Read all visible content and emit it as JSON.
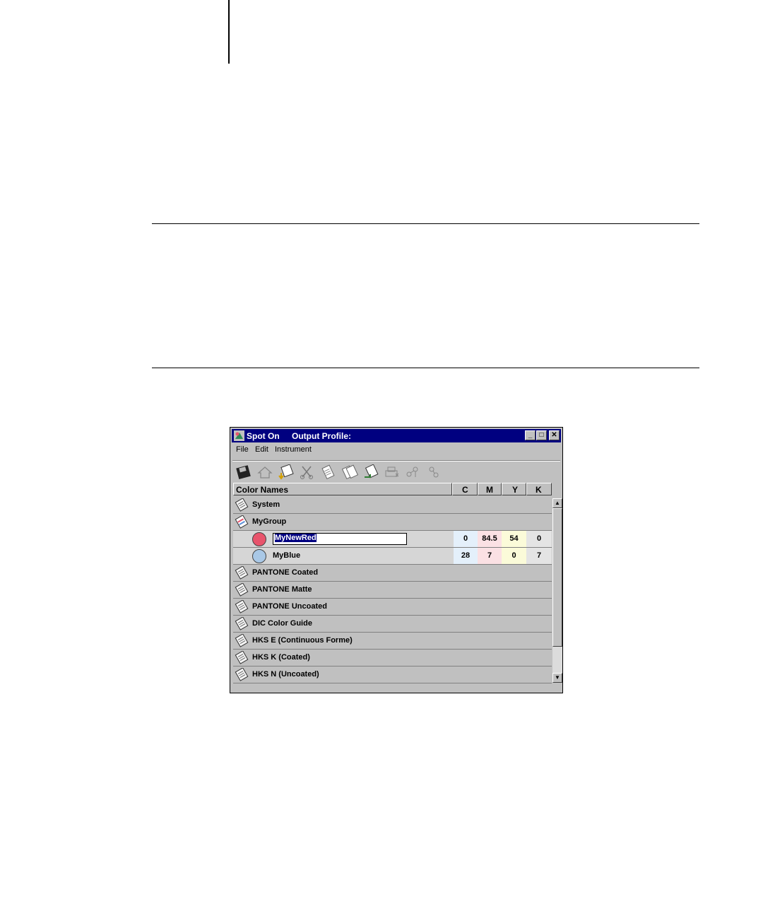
{
  "window": {
    "title": "Spot On",
    "subtitle": "Output Profile:",
    "minimize": "_",
    "maximize": "□",
    "close": "✕"
  },
  "menu": {
    "file": "File",
    "edit": "Edit",
    "instrument": "Instrument"
  },
  "toolbar": [
    "save-icon",
    "home-icon",
    "download-icon",
    "cut-icon",
    "copy-icon",
    "paste-icon",
    "import-icon",
    "print-icon",
    "measure-icon",
    "link-icon"
  ],
  "columns": {
    "name": "Color Names",
    "c": "C",
    "m": "M",
    "y": "Y",
    "k": "K"
  },
  "groups": {
    "system": "System",
    "mygroup": "MyGroup",
    "pantone_coated": "PANTONE Coated",
    "pantone_matte": "PANTONE Matte",
    "pantone_uncoated": "PANTONE Uncoated",
    "dic": "DIC Color Guide",
    "hkse": "HKS E (Continuous Forme)",
    "hksk": "HKS K (Coated)",
    "hksn": "HKS N (Uncoated)"
  },
  "colors": [
    {
      "name": "MyNewRed",
      "swatch": "#e8546c",
      "c": "0",
      "m": "84.5",
      "y": "54",
      "k": "0"
    },
    {
      "name": "MyBlue",
      "swatch": "#a9c8e6",
      "c": "28",
      "m": "7",
      "y": "0",
      "k": "7"
    }
  ],
  "theme": {
    "titlebar": "#000080",
    "cell_c": "#e4f0fb",
    "cell_m": "#fbe1e4",
    "cell_y": "#fbfbd9",
    "cell_k": "#e4e4e4"
  }
}
